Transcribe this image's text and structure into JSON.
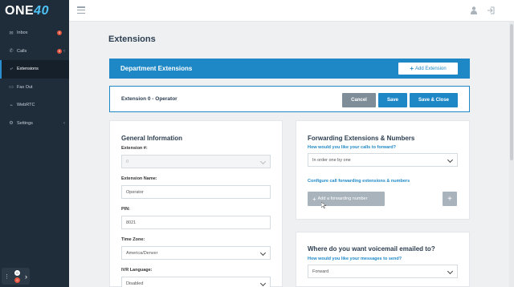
{
  "brand": {
    "logo_prefix": "ONE",
    "logo_suffix": "40"
  },
  "sidebar": {
    "items": [
      {
        "label": "Inbox",
        "icon": "envelope-icon",
        "badge": "0"
      },
      {
        "label": "Calls",
        "icon": "phone-icon",
        "badge": "0",
        "caret": "‹"
      },
      {
        "label": "Extensions",
        "icon": "extensions-icon"
      },
      {
        "label": "Fax Out",
        "icon": "fax-icon"
      },
      {
        "label": "WebRTC",
        "icon": "webrtc-icon"
      },
      {
        "label": "Settings",
        "icon": "gear-icon",
        "caret": "‹"
      }
    ],
    "widget": {
      "badge_top": "0",
      "badge_bottom": "0"
    }
  },
  "page": {
    "title": "Extensions"
  },
  "department": {
    "title": "Department Extensions",
    "add_extension_label": "Add Extension"
  },
  "extension_bar": {
    "title": "Extension 0 - Operator",
    "cancel_label": "Cancel",
    "save_label": "Save",
    "save_close_label": "Save & Close"
  },
  "general_info": {
    "title": "General Information",
    "extension_number_label": "Extension #:",
    "extension_number_value": "0",
    "extension_name_label": "Extension Name:",
    "extension_name_value": "Operator",
    "pin_label": "PIN:",
    "pin_value": "8021",
    "timezone_label": "Time Zone:",
    "timezone_value": "America/Denver",
    "ivr_language_label": "IVR Language:",
    "ivr_language_value": "Disabled"
  },
  "forwarding": {
    "title": "Forwarding Extensions & Numbers",
    "question": "How would you like your calls to forward?",
    "order_value": "In order one by one",
    "configure_label": "Configure call forwarding extensions & numbers",
    "add_forwarding_label": "Add a forwarding number"
  },
  "voicemail": {
    "title": "Where do you want voicemail emailed to?",
    "question": "How would you like your messages to send?",
    "mode_value": "Forward"
  },
  "colors": {
    "accent": "#1e88c7",
    "sidebar_bg": "#1f2d3b",
    "badge": "#e2543f"
  }
}
